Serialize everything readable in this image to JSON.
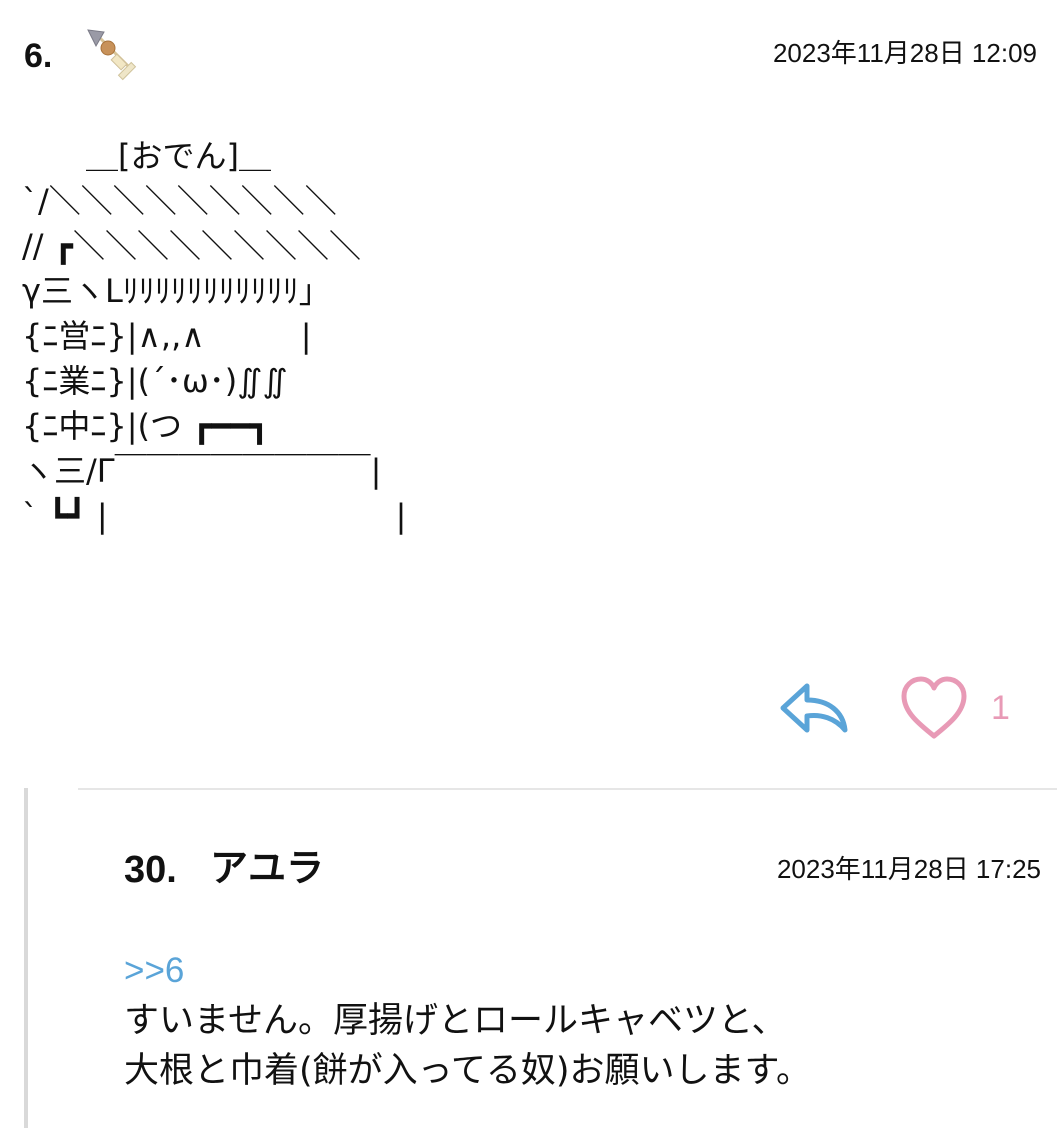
{
  "post": {
    "number": "6.",
    "icon": "oden-skewer-icon",
    "timestamp": "2023年11月28日 12:09",
    "ascii_art": "　　＿[おでん]＿\n`/＼＼＼＼＼＼＼＼＼\n// ┏＼＼＼＼＼＼＼＼＼\nγ三ヽLﾘﾘﾘﾘﾘﾘﾘﾘﾘﾘﾘ」\n{ﾆ営ﾆ}|∧,,∧　　　|\n{ﾆ業ﾆ}|(´･ω･)∬∬\n{ﾆ中ﾆ}|(つ ┏━━┓\nヽ三/Γ￣￣￣￣￣￣￣￣|\n` ┗┛ |　　　　　　　　　|",
    "like_count": "1"
  },
  "reply": {
    "number": "30.",
    "name": "アユラ",
    "timestamp": "2023年11月28日 17:25",
    "anchor": ">>6",
    "lines": [
      "すいません。厚揚げとロールキャベツと、",
      "大根と巾着(餅が入ってる奴)お願いします。"
    ]
  },
  "colors": {
    "reply_icon": "#5aa4d8",
    "like_icon": "#e89ab6",
    "anchor_link": "#5aa4d8",
    "thread_border": "#d9d9d9"
  }
}
